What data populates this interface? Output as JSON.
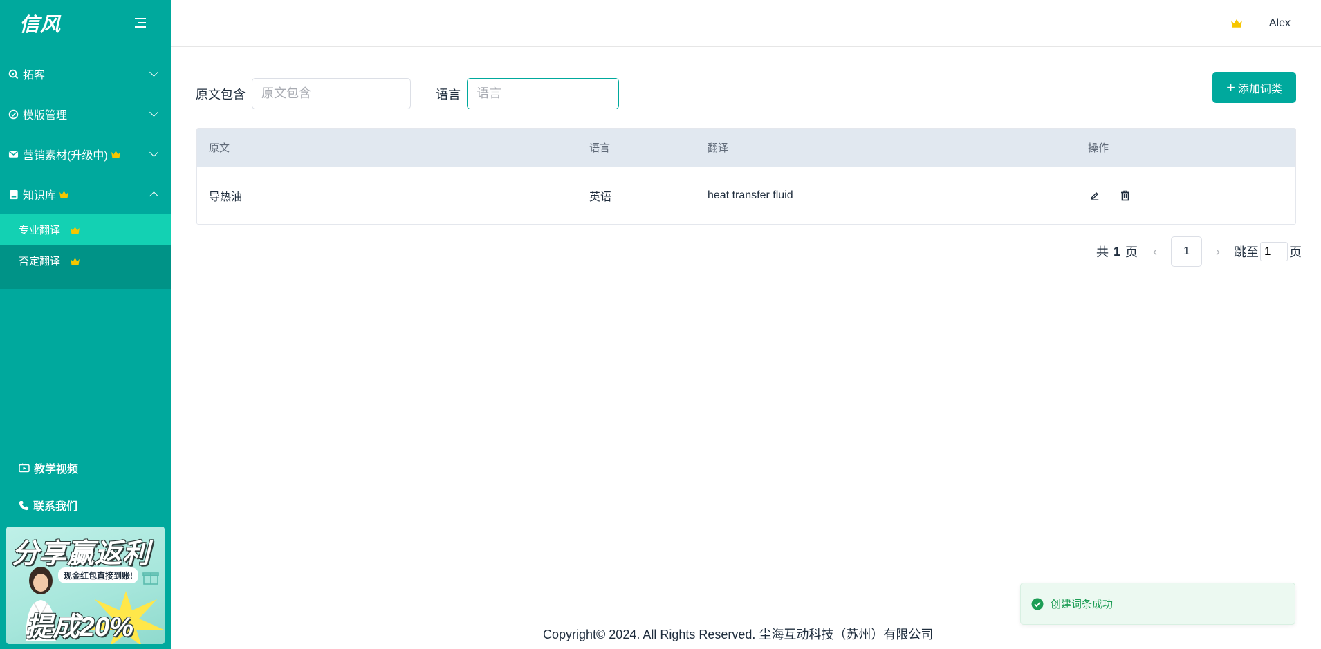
{
  "brand": {
    "logo_text": "信风",
    "accent_color": "#00a99d",
    "sidebar_bg": "#00a99d"
  },
  "sidebar": {
    "menu": [
      {
        "label": "拓客",
        "icon": "search-icon",
        "expanded": false,
        "premium": false
      },
      {
        "label": "模版管理",
        "icon": "check-circle-icon",
        "expanded": false,
        "premium": false
      },
      {
        "label": "营销素材(升级中)",
        "icon": "mail-icon",
        "expanded": false,
        "premium": true
      },
      {
        "label": "知识库",
        "icon": "book-icon",
        "expanded": true,
        "premium": true
      }
    ],
    "submenu": [
      {
        "label": "专业翻译",
        "active": true,
        "premium": true
      },
      {
        "label": "否定翻译",
        "active": false,
        "premium": true
      }
    ],
    "links": {
      "tutorial": "教学视频",
      "contact": "联系我们"
    },
    "promo": {
      "title": "分享赢返利",
      "subtitle": "现金红包直接到账!",
      "rate": "提成20%"
    }
  },
  "header": {
    "username": "Alex",
    "crown_icon": "crown-icon"
  },
  "filters": {
    "source_label": "原文包含",
    "source_placeholder": "原文包含",
    "language_label": "语言",
    "language_placeholder": "语言",
    "add_button": "添加词类"
  },
  "table": {
    "columns": [
      "原文",
      "语言",
      "翻译",
      "操作"
    ],
    "rows": [
      {
        "source": "导热油",
        "language": "英语",
        "translation": "heat transfer fluid"
      }
    ]
  },
  "pagination": {
    "total_prefix": "共",
    "total_pages": "1",
    "total_suffix": "页",
    "current_page": "1",
    "jump_prefix": "跳至",
    "jump_value": "1",
    "jump_suffix": "页"
  },
  "toast": {
    "message": "创建词条成功",
    "status_color": "#1d9d55"
  },
  "footer": {
    "copyright": "Copyright© 2024. All Rights Reserved. 尘海互动科技（苏州）有限公司"
  }
}
